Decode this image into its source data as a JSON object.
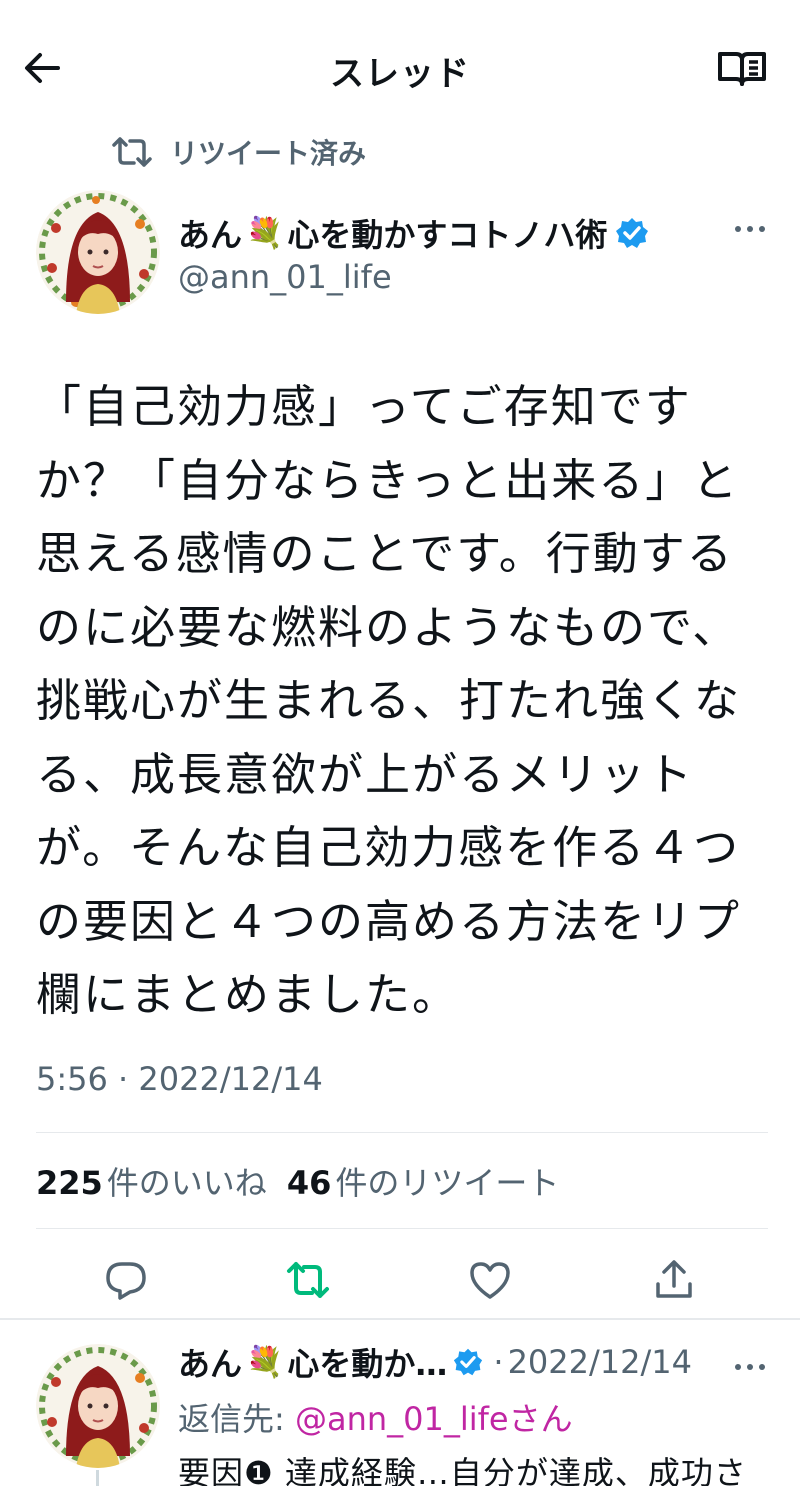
{
  "header": {
    "title": "スレッド"
  },
  "retweet": {
    "label": "リツイート済み"
  },
  "tweet": {
    "author_name": "あん",
    "author_flower": "💐",
    "author_tagline": "心を動かすコトノハ術",
    "author_handle": "@ann_01_life",
    "text": "「自己効力感」ってご存知ですか？「自分ならきっと出来る」と思える感情のことです。行動するのに必要な燃料のようなもので、挑戦心が生まれる、打たれ強くなる、成長意欲が上がるメリットが。そんな自己効力感を作る４つの要因と４つの高める方法をリプ欄にまとめました。",
    "timestamp": "5:56 · 2022/12/14",
    "likes_count": "225",
    "likes_label": "件のいいね",
    "retweets_count": "46",
    "retweets_label": "件のリツイート"
  },
  "reply": {
    "author_name": "あん",
    "author_flower": "💐",
    "author_tagline": "心を動か…",
    "date": "2022/12/14",
    "reply_prefix": "返信先: ",
    "reply_mention": "@ann_01_life",
    "reply_suffix": "さん",
    "text": "要因❶ 達成経験…自分が達成、成功さ"
  },
  "colors": {
    "text_primary": "#0f1419",
    "text_secondary": "#536471",
    "retweet_active": "#00ba7c",
    "verified": "#1d9bf0",
    "mention": "#c026a3"
  },
  "icons": {
    "back": "arrow-left-icon",
    "reader": "book-open-icon",
    "retweet_indicator": "retweet-icon",
    "verified": "verified-badge-icon",
    "more": "more-dots-icon",
    "reply": "reply-bubble-icon",
    "retweet": "retweet-icon",
    "like": "heart-icon",
    "share": "share-icon"
  }
}
